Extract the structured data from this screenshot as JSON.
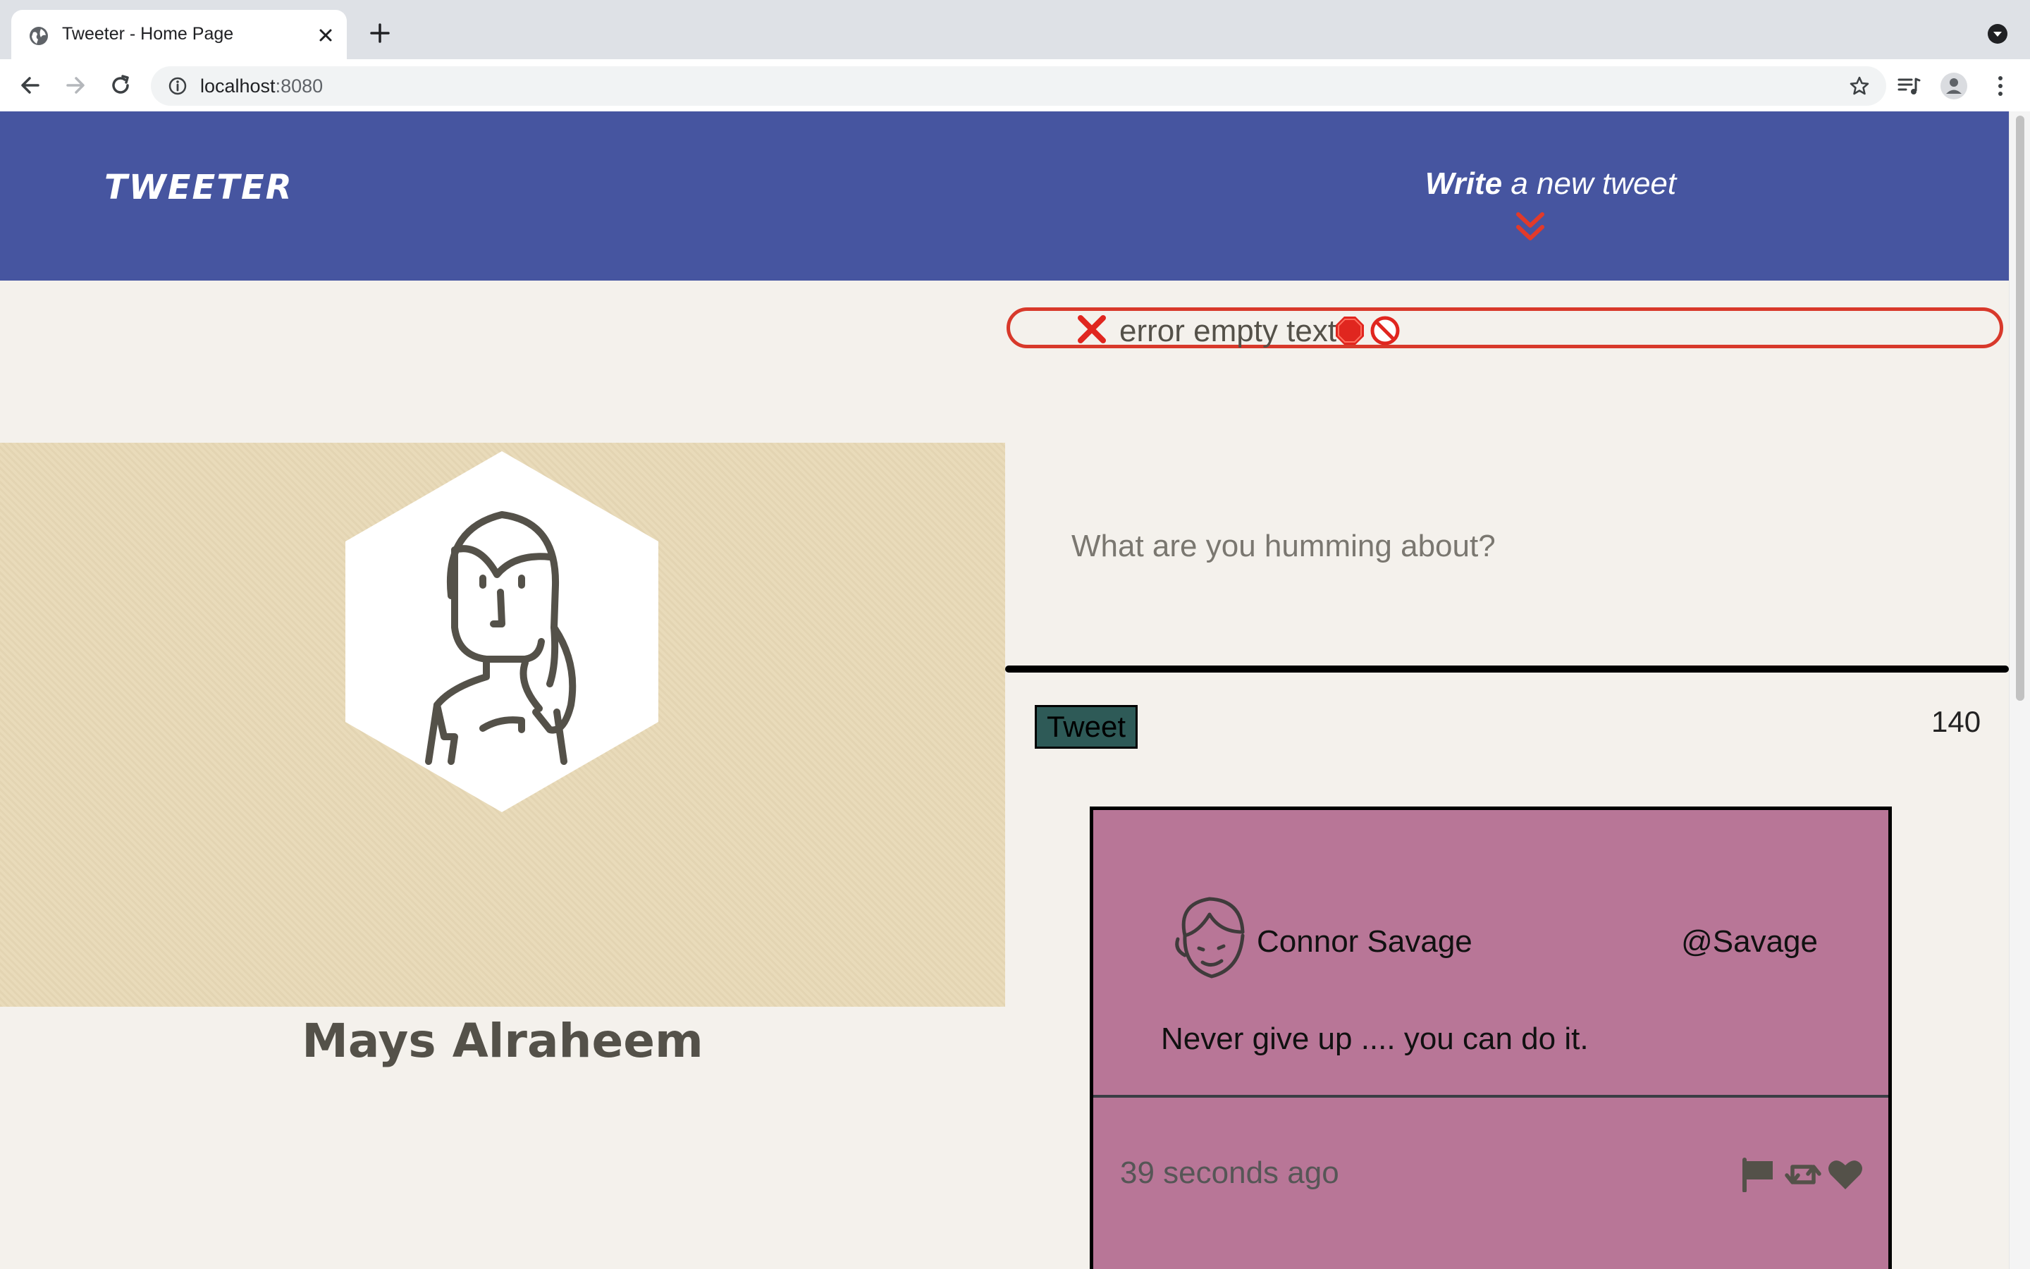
{
  "browser": {
    "tab_title": "Tweeter - Home Page",
    "url_host": "localhost",
    "url_port": ":8080"
  },
  "nav": {
    "brand": "TWEETER",
    "compose_bold": "Write",
    "compose_rest": " a new tweet"
  },
  "error": {
    "message": "error empty text"
  },
  "profile": {
    "name": "Mays Alraheem"
  },
  "composer": {
    "placeholder": "What are you humming about?",
    "button_label": "Tweet",
    "counter": "140"
  },
  "tweets": [
    {
      "author": "Connor Savage",
      "handle": "@Savage",
      "content": "Never give up .... you can do it.",
      "time_ago": "39 seconds ago",
      "icons": [
        "flag-icon",
        "retweet-icon",
        "heart-icon"
      ]
    }
  ],
  "colors": {
    "navbar": "#4655a0",
    "page_bg": "#f4f1ec",
    "profile_bg": "#e8d9b6",
    "tweet_bg": "#b87697",
    "button_bg": "#2e5a57",
    "error_border": "#d8392b"
  }
}
